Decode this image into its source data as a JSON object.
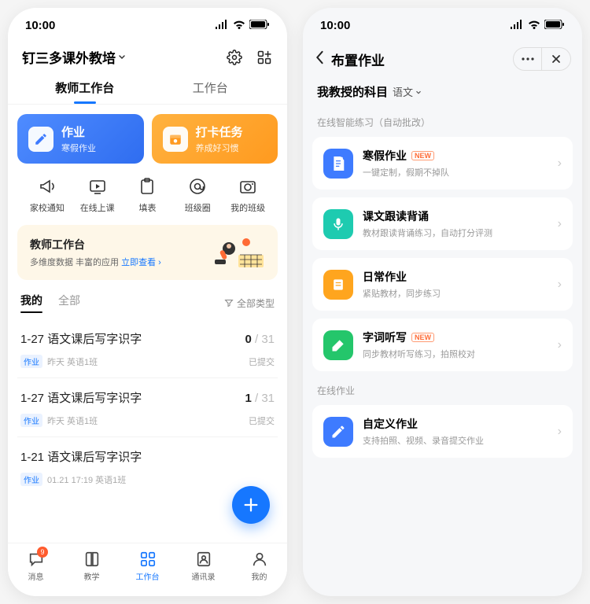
{
  "status": {
    "time": "10:00"
  },
  "screen1": {
    "header": {
      "title": "钉三多课外教培",
      "tabs": [
        "教师工作台",
        "工作台"
      ],
      "active_tab": 0
    },
    "features": [
      {
        "title": "作业",
        "sub": "寒假作业",
        "color": "blue"
      },
      {
        "title": "打卡任务",
        "sub": "养成好习惯",
        "color": "orange"
      }
    ],
    "quick": [
      {
        "label": "家校通知",
        "icon": "megaphone"
      },
      {
        "label": "在线上课",
        "icon": "play-screen"
      },
      {
        "label": "填表",
        "icon": "clipboard"
      },
      {
        "label": "班级圈",
        "icon": "circle-at"
      },
      {
        "label": "我的班级",
        "icon": "photo-gear"
      }
    ],
    "banner": {
      "title": "教师工作台",
      "sub": "多维度数据 丰富的应用",
      "link": "立即查看"
    },
    "filter": {
      "tabs": [
        "我的",
        "全部"
      ],
      "active": 0,
      "type_label": "全部类型"
    },
    "homework": [
      {
        "title": "1-27 语文课后写字识字",
        "done": "0",
        "total": "31",
        "tag": "作业",
        "meta": "昨天 英语1班",
        "status": "已提交"
      },
      {
        "title": "1-27 语文课后写字识字",
        "done": "1",
        "total": "31",
        "tag": "作业",
        "meta": "昨天 英语1班",
        "status": "已提交"
      },
      {
        "title": "1-21 语文课后写字识字",
        "done": "",
        "total": "",
        "tag": "作业",
        "meta": "01.21 17:19 英语1班",
        "status": ""
      }
    ],
    "nav": {
      "items": [
        {
          "label": "消息",
          "icon": "chat",
          "badge": "9"
        },
        {
          "label": "教学",
          "icon": "book"
        },
        {
          "label": "工作台",
          "icon": "grid",
          "active": true
        },
        {
          "label": "通讯录",
          "icon": "contact"
        },
        {
          "label": "我的",
          "icon": "person"
        }
      ]
    }
  },
  "screen2": {
    "header": {
      "title": "布置作业"
    },
    "subject": {
      "label": "我教授的科目",
      "selected": "语文"
    },
    "sections": [
      {
        "label": "在线智能练习（自动批改）",
        "items": [
          {
            "title": "寒假作业",
            "sub": "一键定制，假期不掉队",
            "new": true,
            "color": "#3e7bff",
            "icon": "doc"
          },
          {
            "title": "课文跟读背诵",
            "sub": "教材跟读背诵练习，自动打分评测",
            "new": false,
            "color": "#1ecbb0",
            "icon": "mic"
          },
          {
            "title": "日常作业",
            "sub": "紧贴教材，同步练习",
            "new": false,
            "color": "#ffa51e",
            "icon": "book2"
          },
          {
            "title": "字词听写",
            "sub": "同步教材听写练习，拍照校对",
            "new": true,
            "color": "#24c66b",
            "icon": "pen"
          }
        ]
      },
      {
        "label": "在线作业",
        "items": [
          {
            "title": "自定义作业",
            "sub": "支持拍照、视频、录音提交作业",
            "new": false,
            "color": "#3e7bff",
            "icon": "pencil"
          }
        ]
      }
    ]
  }
}
